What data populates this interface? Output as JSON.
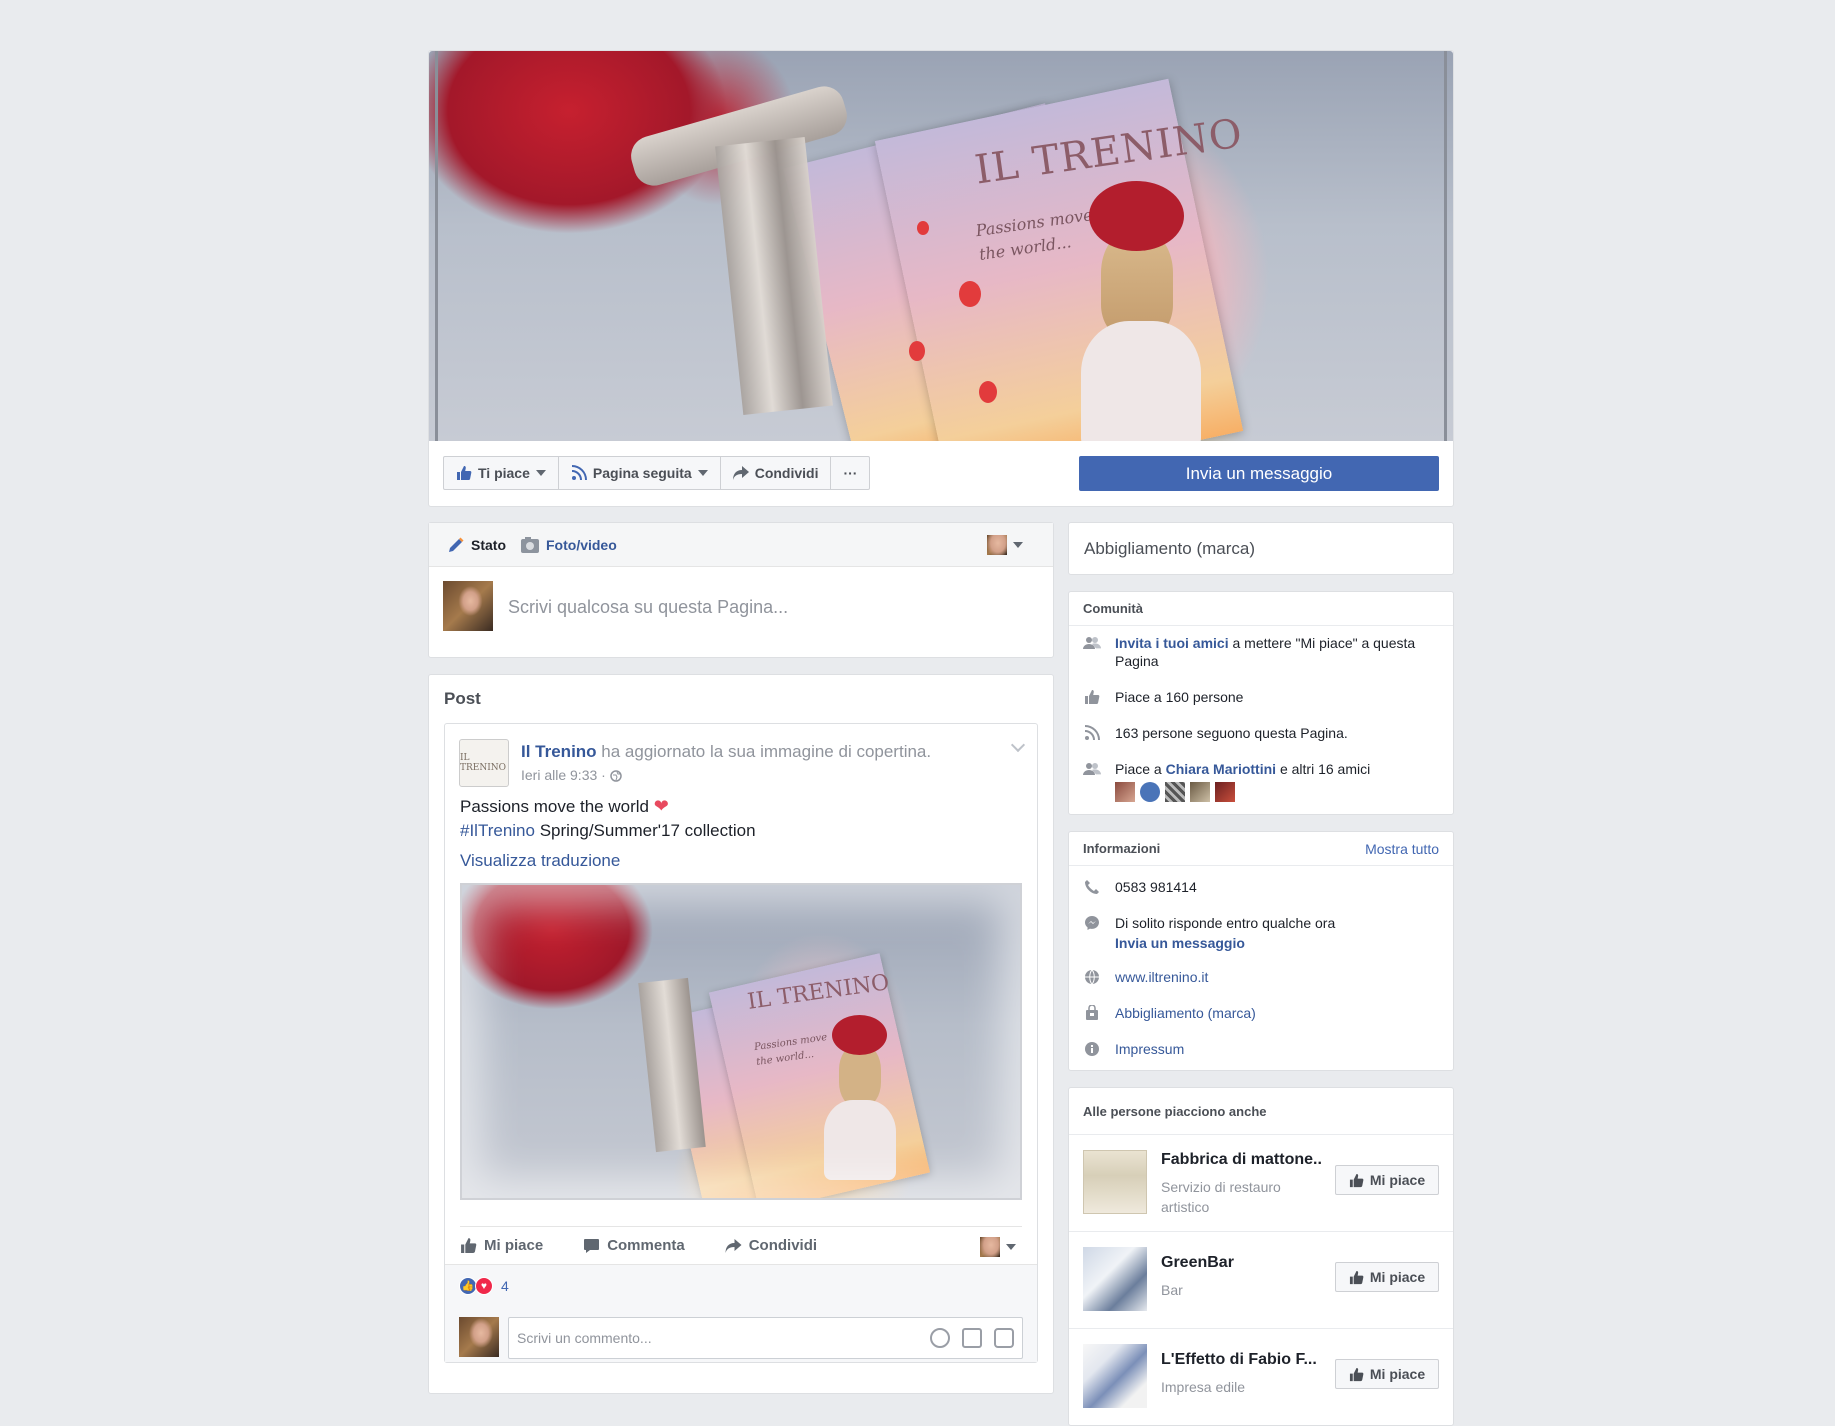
{
  "cover": {
    "logo_text": "IL TRENINO",
    "tagline_line1": "Passions move",
    "tagline_line2": "the world..."
  },
  "actions": {
    "like_label": "Ti piace",
    "follow_label": "Pagina seguita",
    "share_label": "Condividi",
    "more_label": "···",
    "message_label": "Invia un messaggio"
  },
  "composer": {
    "tab_status": "Stato",
    "tab_photo": "Foto/video",
    "placeholder": "Scrivi qualcosa su questa Pagina..."
  },
  "posts": {
    "title": "Post",
    "post": {
      "page_logo_text": "IL TRENINO",
      "author": "Il Trenino",
      "action_text": " ha aggiornato la sua immagine di copertina.",
      "time": "Ieri alle 9:33 · ",
      "line1": "Passions move the world ",
      "hashtag": "#IlTrenino",
      "line2": " Spring/Summer'17 collection",
      "translate": "Visualizza traduzione",
      "image_logo": "IL TRENINO",
      "image_tag1": "Passions move",
      "image_tag2": "the world...",
      "like": "Mi piace",
      "comment": "Commenta",
      "share": "Condividi",
      "reactions_count": "4",
      "comment_placeholder": "Scrivi un commento..."
    }
  },
  "sidebar": {
    "category": "Abbigliamento (marca)",
    "community": {
      "title": "Comunità",
      "invite_link": "Invita i tuoi amici",
      "invite_rest": " a mettere \"Mi piace\" a questa Pagina",
      "likes": "Piace a 160 persone",
      "follows": "163 persone seguono questa Pagina.",
      "friends_prefix": "Piace a ",
      "friend_name": "Chiara Mariottini",
      "friends_suffix": " e altri 16 amici"
    },
    "info": {
      "title": "Informazioni",
      "show_all": "Mostra tutto",
      "phone": "0583 981414",
      "response": "Di solito risponde entro qualche ora",
      "send_message": "Invia un messaggio",
      "website": "www.iltrenino.it",
      "category": "Abbigliamento (marca)",
      "impressum": "Impressum"
    },
    "suggestions": {
      "title": "Alle persone piacciono anche",
      "items": [
        {
          "name": "Fabbrica di mattone..",
          "category": "Servizio di restauro artistico",
          "button": "Mi piace"
        },
        {
          "name": "GreenBar",
          "category": "Bar",
          "button": "Mi piace"
        },
        {
          "name": "L'Effetto di Fabio F...",
          "category": "Impresa edile",
          "button": "Mi piace"
        }
      ]
    }
  },
  "colors": {
    "accent": "#4267b2",
    "link": "#365899",
    "background": "#e9ebee"
  }
}
